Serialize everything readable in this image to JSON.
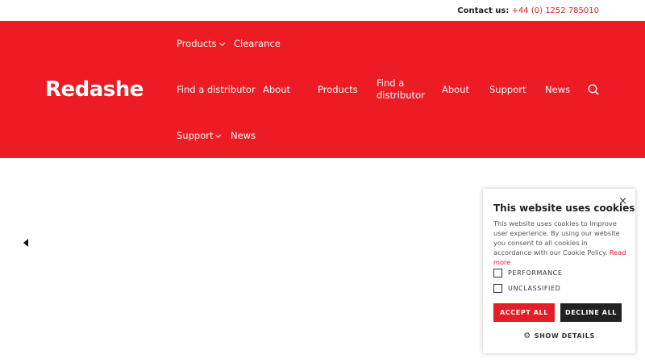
{
  "topbar": {
    "contact_label": "Contact us:",
    "phone": "+44 (0) 1252 785010"
  },
  "header": {
    "logo_text": "Redashe",
    "nav": {
      "products": "Products",
      "clearance": "Clearance",
      "find_distributor": "Find a distributor",
      "about": "About",
      "products_main": "Products",
      "find_distributor_main_1": "Find a",
      "find_distributor_main_2": "distributor",
      "about_main": "About",
      "support_main": "Support",
      "news_main": "News",
      "support": "Support",
      "news": "News"
    },
    "search_icon": "search-icon"
  },
  "colors": {
    "brand_red": "#ed1c24",
    "decline_dark": "#222222"
  },
  "cookie": {
    "title": "This website uses cookies",
    "body": "This website uses cookies to improve user experience. By using our website you consent to all cookies in accordance with our Cookie Policy.",
    "read_more": "Read more",
    "close": "×",
    "options": [
      "PERFORMANCE",
      "UNCLASSIFIED"
    ],
    "accept": "ACCEPT ALL",
    "decline": "DECLINE ALL",
    "show_details": "SHOW DETAILS"
  }
}
